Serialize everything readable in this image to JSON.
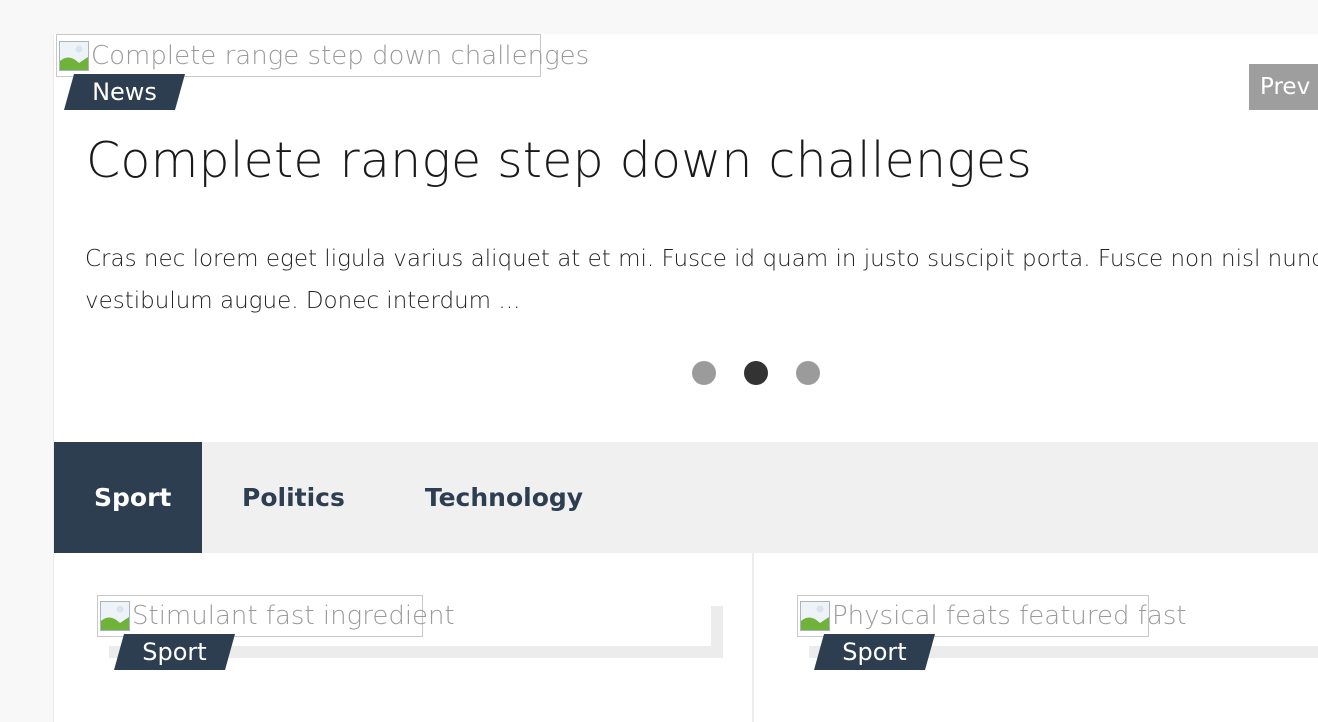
{
  "hero": {
    "image_alt": "Complete range step down challenges",
    "category": "News",
    "title": "Complete range step down challenges",
    "excerpt_line1": "Cras nec lorem eget ligula varius aliquet at et mi. Fusce id quam in justo suscipit porta. Fusce non nisl nunc",
    "excerpt_line2": "vestibulum augue. Donec interdum ...",
    "prev_label": "Prev",
    "dots": 3,
    "active_dot": 2
  },
  "tabs": [
    {
      "label": "Sport",
      "active": true
    },
    {
      "label": "Politics",
      "active": false
    },
    {
      "label": "Technology",
      "active": false
    }
  ],
  "cards": [
    {
      "image_alt": "Stimulant fast ingredient",
      "category": "Sport"
    },
    {
      "image_alt": "Physical feats featured fast",
      "category": "Sport"
    }
  ],
  "colors": {
    "accent": "#2c3e50",
    "tab_bar": "#f0f0f0",
    "dot_inactive": "#9b9b9b",
    "dot_active": "#333333",
    "prev_button": "#9e9e9e"
  },
  "icons": {
    "broken_image": "broken-image-icon"
  }
}
